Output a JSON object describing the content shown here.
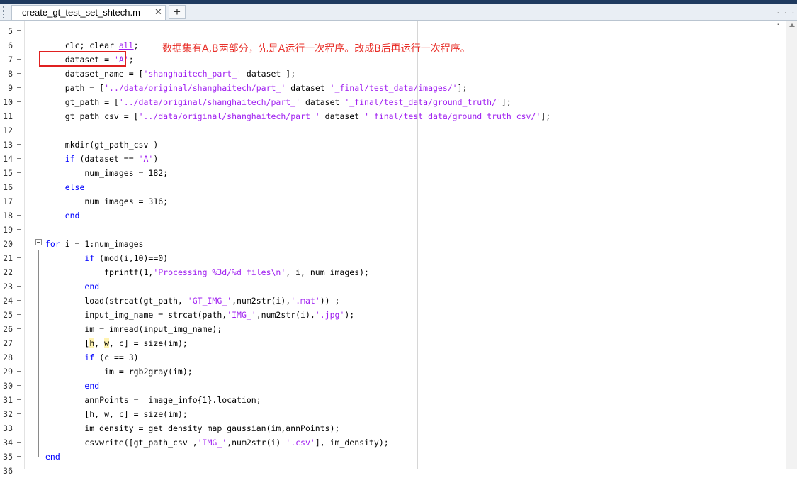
{
  "window": {
    "tab_title": "create_gt_test_set_shtech.m",
    "tab_close": "✕",
    "new_tab": "+",
    "overflow_dots": "· · · ·"
  },
  "annotation": {
    "text": "数据集有A,B两部分，先是A运行一次程序。改成B后再运行一次程序。",
    "color": "#e8302a"
  },
  "colors": {
    "keyword": "#0000ff",
    "string": "#a020f0",
    "highlight_box": "#e02020"
  },
  "lines": [
    {
      "n": "5",
      "segs": []
    },
    {
      "n": "6",
      "segs": [
        {
          "t": "    clc; clear "
        },
        {
          "t": "all",
          "c": "str",
          "u": true
        },
        {
          "t": ";"
        }
      ]
    },
    {
      "n": "7",
      "segs": [
        {
          "t": "    dataset = "
        },
        {
          "t": "'A'",
          "c": "str"
        },
        {
          "t": ";"
        }
      ]
    },
    {
      "n": "8",
      "segs": [
        {
          "t": "    dataset_name = ["
        },
        {
          "t": "'shanghaitech_part_'",
          "c": "str"
        },
        {
          "t": " dataset ];"
        }
      ]
    },
    {
      "n": "9",
      "segs": [
        {
          "t": "    path = ["
        },
        {
          "t": "'../data/original/shanghaitech/part_'",
          "c": "str"
        },
        {
          "t": " dataset "
        },
        {
          "t": "'_final/test_data/images/'",
          "c": "str"
        },
        {
          "t": "];"
        }
      ]
    },
    {
      "n": "10",
      "segs": [
        {
          "t": "    gt_path = ["
        },
        {
          "t": "'../data/original/shanghaitech/part_'",
          "c": "str"
        },
        {
          "t": " dataset "
        },
        {
          "t": "'_final/test_data/ground_truth/'",
          "c": "str"
        },
        {
          "t": "];"
        }
      ]
    },
    {
      "n": "11",
      "segs": [
        {
          "t": "    gt_path_csv = ["
        },
        {
          "t": "'../data/original/shanghaitech/part_'",
          "c": "str"
        },
        {
          "t": " dataset "
        },
        {
          "t": "'_final/test_data/ground_truth_csv/'",
          "c": "str"
        },
        {
          "t": "];"
        }
      ]
    },
    {
      "n": "12",
      "segs": []
    },
    {
      "n": "13",
      "segs": [
        {
          "t": "    mkdir(gt_path_csv )"
        }
      ]
    },
    {
      "n": "14",
      "segs": [
        {
          "t": "    "
        },
        {
          "t": "if",
          "c": "kw"
        },
        {
          "t": " (dataset == "
        },
        {
          "t": "'A'",
          "c": "str"
        },
        {
          "t": ")"
        }
      ]
    },
    {
      "n": "15",
      "segs": [
        {
          "t": "        num_images = 182;"
        }
      ]
    },
    {
      "n": "16",
      "segs": [
        {
          "t": "    "
        },
        {
          "t": "else",
          "c": "kw"
        }
      ]
    },
    {
      "n": "17",
      "segs": [
        {
          "t": "        num_images = 316;"
        }
      ]
    },
    {
      "n": "18",
      "segs": [
        {
          "t": "    "
        },
        {
          "t": "end",
          "c": "kw"
        }
      ]
    },
    {
      "n": "19",
      "segs": []
    },
    {
      "n": "20",
      "segs": [
        {
          "t": "for",
          "c": "kw"
        },
        {
          "t": " i = 1:num_images"
        }
      ]
    },
    {
      "n": "21",
      "segs": [
        {
          "t": "        "
        },
        {
          "t": "if",
          "c": "kw"
        },
        {
          "t": " (mod(i,10)==0)"
        }
      ]
    },
    {
      "n": "22",
      "segs": [
        {
          "t": "            fprintf(1,"
        },
        {
          "t": "'Processing %3d/%d files\\n'",
          "c": "str"
        },
        {
          "t": ", i, num_images);"
        }
      ]
    },
    {
      "n": "23",
      "segs": [
        {
          "t": "        "
        },
        {
          "t": "end",
          "c": "kw"
        }
      ]
    },
    {
      "n": "24",
      "segs": [
        {
          "t": "        load(strcat(gt_path, "
        },
        {
          "t": "'GT_IMG_'",
          "c": "str"
        },
        {
          "t": ",num2str(i),"
        },
        {
          "t": "'.mat'",
          "c": "str"
        },
        {
          "t": ")) ;"
        }
      ]
    },
    {
      "n": "25",
      "segs": [
        {
          "t": "        input_img_name = strcat(path,"
        },
        {
          "t": "'IMG_'",
          "c": "str"
        },
        {
          "t": ",num2str(i),"
        },
        {
          "t": "'.jpg'",
          "c": "str"
        },
        {
          "t": ");"
        }
      ]
    },
    {
      "n": "26",
      "segs": [
        {
          "t": "        im = imread(input_img_name);"
        }
      ]
    },
    {
      "n": "27",
      "segs": [
        {
          "t": "        ["
        },
        {
          "t": "h",
          "c": "hl"
        },
        {
          "t": ", "
        },
        {
          "t": "w",
          "c": "hl"
        },
        {
          "t": ", c] = size(im);"
        }
      ]
    },
    {
      "n": "28",
      "segs": [
        {
          "t": "        "
        },
        {
          "t": "if",
          "c": "kw"
        },
        {
          "t": " (c == 3)"
        }
      ]
    },
    {
      "n": "29",
      "segs": [
        {
          "t": "            im = rgb2gray(im);"
        }
      ]
    },
    {
      "n": "30",
      "segs": [
        {
          "t": "        "
        },
        {
          "t": "end",
          "c": "kw"
        }
      ]
    },
    {
      "n": "31",
      "segs": [
        {
          "t": "        annPoints =  image_info{1}.location;"
        }
      ]
    },
    {
      "n": "32",
      "segs": [
        {
          "t": "        [h, w, c] = size(im);"
        }
      ]
    },
    {
      "n": "33",
      "segs": [
        {
          "t": "        im_density = get_density_map_gaussian(im,annPoints);"
        }
      ]
    },
    {
      "n": "34",
      "segs": [
        {
          "t": "        csvwrite([gt_path_csv ,"
        },
        {
          "t": "'IMG_'",
          "c": "str"
        },
        {
          "t": ",num2str(i) "
        },
        {
          "t": "'.csv'",
          "c": "str"
        },
        {
          "t": "], im_density);"
        }
      ]
    },
    {
      "n": "35",
      "segs": [
        {
          "t": "end",
          "c": "kw"
        }
      ]
    },
    {
      "n": "36",
      "segs": []
    }
  ]
}
